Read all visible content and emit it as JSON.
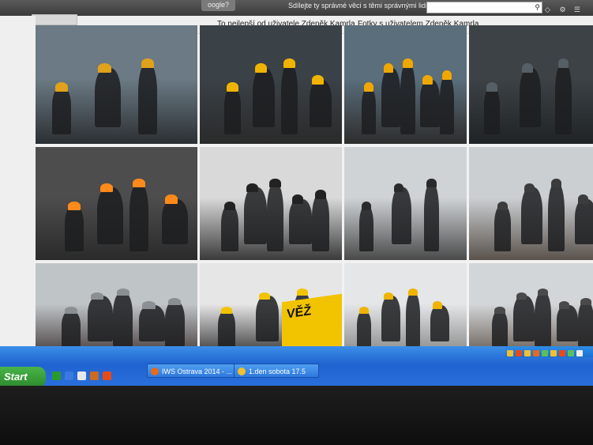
{
  "browser": {
    "tab_fragment": "oogle?",
    "tagline": "Sdílejte ty správné věci s těmi správnými lidmi.",
    "icons": [
      "search-icon",
      "lock-icon",
      "gear-icon",
      "menu-icon"
    ]
  },
  "nav": {
    "best_of_user": "To nejlepší od uživatele Zdeněk Kamrla",
    "photos_with_user": "Fotky s uživatelem Zdeněk Kamrla"
  },
  "photos": [
    {
      "name": "photo-helmets-stairs",
      "sky": "#6b7a84",
      "ground": "#2b2f33",
      "accent": "#e0a21a"
    },
    {
      "name": "photo-group-railing",
      "sky": "#3a4147",
      "ground": "#2a2a2a",
      "accent": "#f0b400"
    },
    {
      "name": "photo-helmets-orange-vest",
      "sky": "#5a6e7c",
      "ground": "#2d2d2d",
      "accent": "#f0a800"
    },
    {
      "name": "photo-rainy-window",
      "sky": "#3c4246",
      "ground": "#1f2326",
      "accent": "#555f66"
    },
    {
      "name": "photo-woman-white-helmet",
      "sky": "#4d4d4d",
      "ground": "#2a2a2a",
      "accent": "#ff8a1a"
    },
    {
      "name": "photo-people-tower-view",
      "sky": "#d9d9d9",
      "ground": "#3a3a3a",
      "accent": "#222"
    },
    {
      "name": "photo-blast-furnace-tank",
      "sky": "#cfd3d6",
      "ground": "#4a4a4a",
      "accent": "#2a2a2a"
    },
    {
      "name": "photo-industrial-skyline",
      "sky": "#cbcfd2",
      "ground": "#5a524c",
      "accent": "#3c3c3c"
    },
    {
      "name": "photo-steel-structure",
      "sky": "#bfc4c7",
      "ground": "#4a4040",
      "accent": "#8a8f94"
    },
    {
      "name": "photo-man-with-camera-vez",
      "sky": "#e6e6e6",
      "ground": "#3a3a3a",
      "accent": "#f2c400"
    },
    {
      "name": "photo-woman-camera-helmet",
      "sky": "#e4e6e8",
      "ground": "#8a8a8a",
      "accent": "#f0b400"
    },
    {
      "name": "photo-rooftops-city",
      "sky": "#d3d6d8",
      "ground": "#6a6058",
      "accent": "#4a4a4a"
    }
  ],
  "vez_sign": "VĚŽ",
  "taskbar": {
    "start_label": "Start",
    "tasks": [
      {
        "label": "IWS Ostrava 2014 - ...",
        "icon_color": "#e86a1a"
      },
      {
        "label": "1.den sobota 17.5",
        "icon_color": "#f0c030"
      }
    ],
    "quick_launch_colors": [
      "#2a9a2a",
      "#3a7ae0",
      "#e8e8e8",
      "#cc6a20",
      "#e84a1a"
    ],
    "tray_colors": [
      "#f0c030",
      "#e84a1a",
      "#f0c030",
      "#e86a1a",
      "#5ac05a",
      "#f0c030",
      "#e84a1a",
      "#5ac05a",
      "#eee"
    ]
  }
}
